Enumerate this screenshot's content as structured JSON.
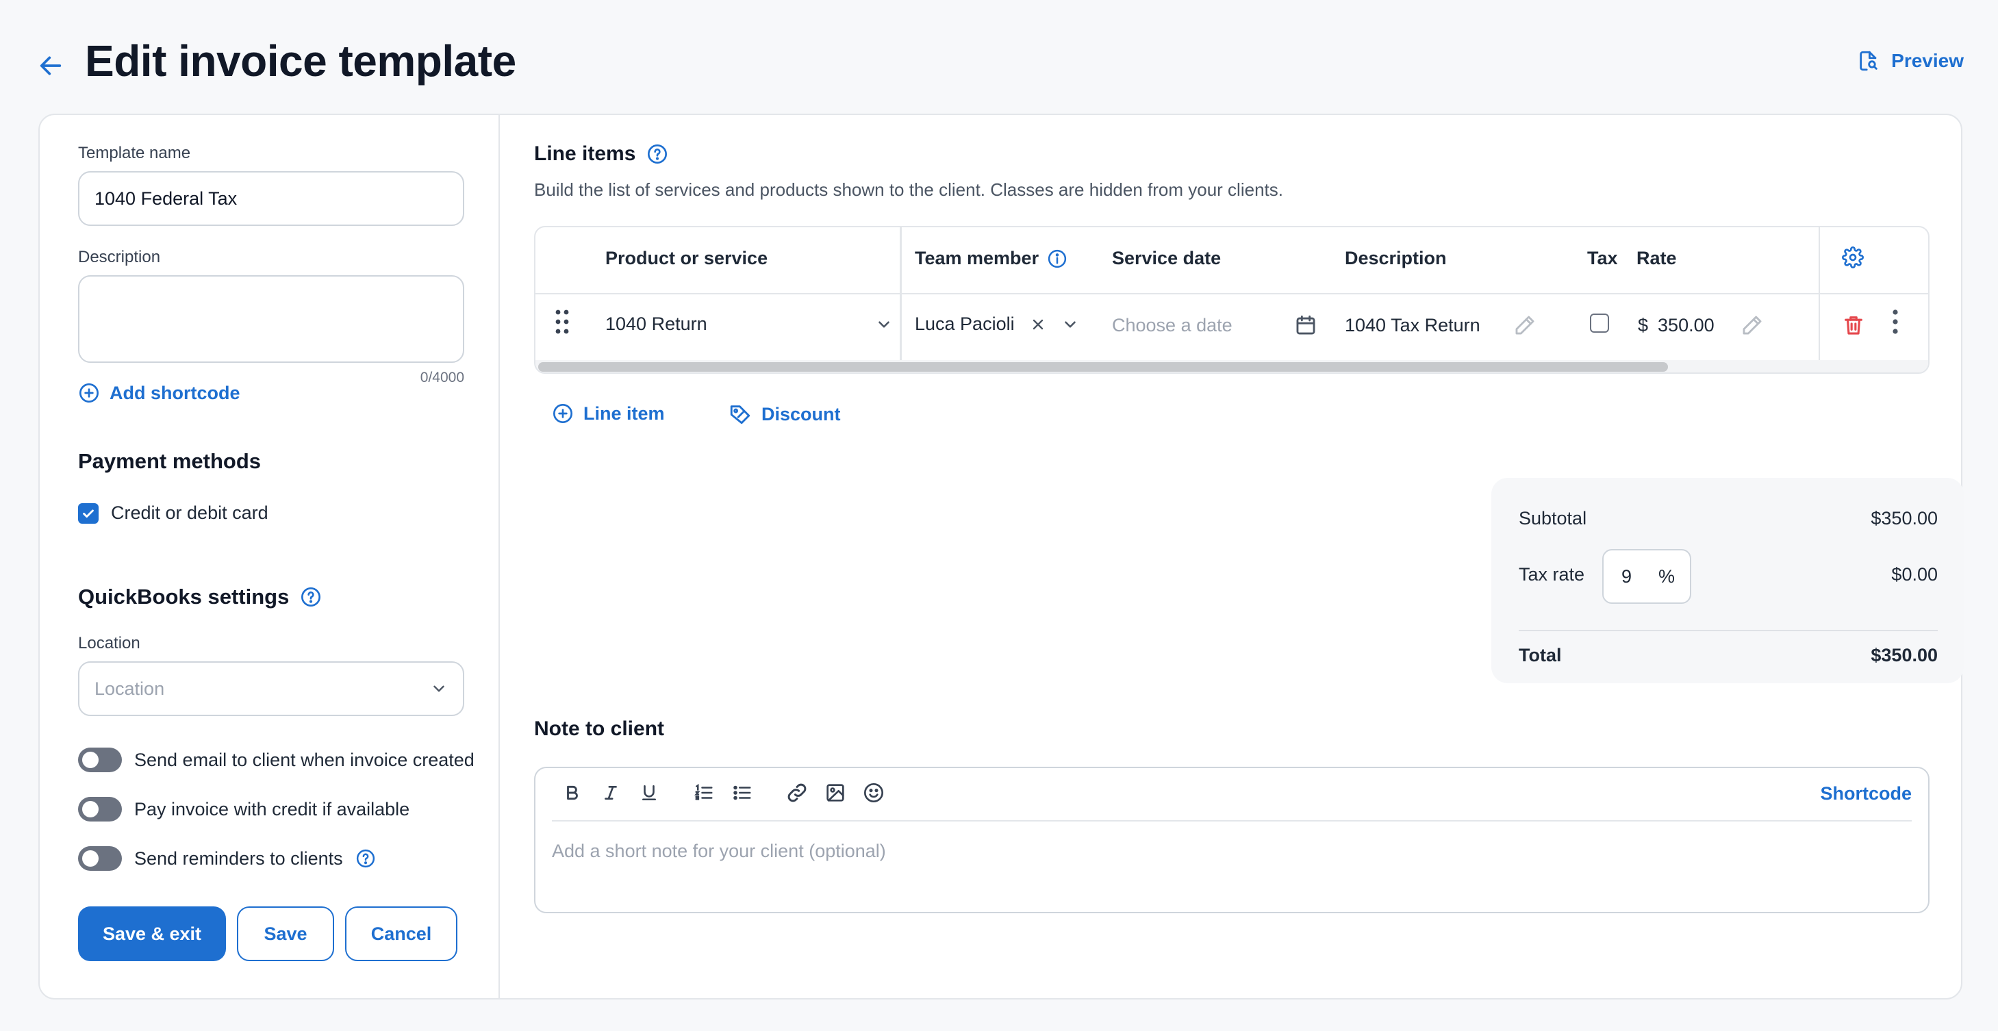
{
  "header": {
    "title": "Edit invoice template",
    "preview_label": "Preview"
  },
  "left": {
    "template_name_label": "Template name",
    "template_name_value": "1040 Federal Tax",
    "description_label": "Description",
    "description_value": "",
    "description_counter": "0/4000",
    "add_shortcode_label": "Add shortcode",
    "payment_methods_title": "Payment methods",
    "payment_methods": [
      {
        "label": "Credit or debit card",
        "checked": true
      }
    ],
    "quickbooks_title": "QuickBooks settings",
    "location_label": "Location",
    "location_placeholder": "Location",
    "toggles": [
      {
        "label": "Send email to client when invoice created",
        "on": false
      },
      {
        "label": "Pay invoice with credit if available",
        "on": false
      },
      {
        "label": "Send reminders to clients",
        "on": false
      }
    ],
    "buttons": {
      "save_exit": "Save & exit",
      "save": "Save",
      "cancel": "Cancel"
    }
  },
  "line_items": {
    "title": "Line items",
    "subtitle": "Build the list of services and products shown to the client. Classes are hidden from your clients.",
    "columns": {
      "product": "Product or service",
      "team": "Team member",
      "date": "Service date",
      "description": "Description",
      "tax": "Tax",
      "rate": "Rate"
    },
    "rows": [
      {
        "product": "1040 Return",
        "team": "Luca Pacioli",
        "date_placeholder": "Choose a date",
        "description": "1040 Tax Return",
        "tax": false,
        "currency": "$",
        "rate": "350.00"
      }
    ],
    "add_line_item_label": "Line item",
    "add_discount_label": "Discount"
  },
  "totals": {
    "subtotal_label": "Subtotal",
    "subtotal_value": "$350.00",
    "tax_rate_label": "Tax rate",
    "tax_rate_value": "9",
    "tax_rate_unit": "%",
    "tax_value": "$0.00",
    "total_label": "Total",
    "total_value": "$350.00"
  },
  "note": {
    "title": "Note to client",
    "placeholder": "Add a short note for your client (optional)",
    "shortcode_label": "Shortcode"
  },
  "colors": {
    "accent": "#1e6fd0",
    "danger": "#e5484d"
  }
}
